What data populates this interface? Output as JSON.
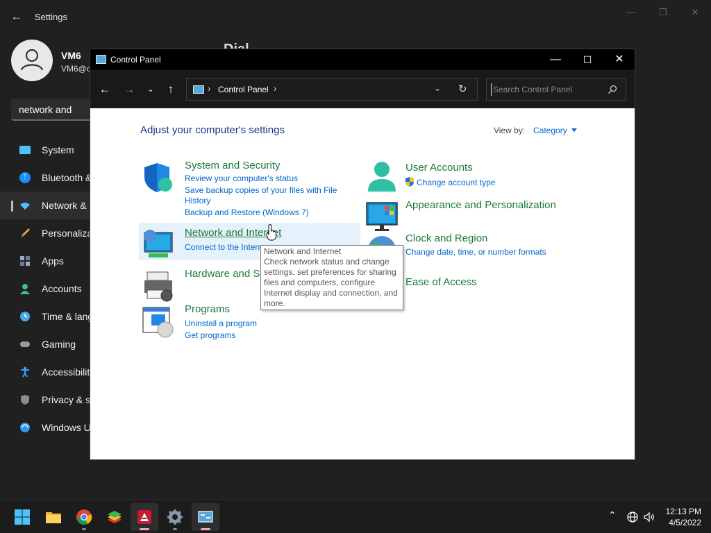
{
  "settings": {
    "title": "Settings",
    "user_name": "VM6",
    "user_email": "VM6@c",
    "page_peek": "Dial",
    "search_value": "network and",
    "nav": [
      {
        "label": "System",
        "icon": "system-icon",
        "color": "#4cc2ff"
      },
      {
        "label": "Bluetooth &",
        "icon": "bluetooth-icon",
        "color": "#1a8cff"
      },
      {
        "label": "Network &",
        "icon": "wifi-icon",
        "color": "#4cc2ff",
        "active": true
      },
      {
        "label": "Personaliza",
        "icon": "brush-icon",
        "color": "#f0a24a"
      },
      {
        "label": "Apps",
        "icon": "apps-icon",
        "color": "#9aa7c8"
      },
      {
        "label": "Accounts",
        "icon": "accounts-icon",
        "color": "#3dc08a"
      },
      {
        "label": "Time & lang",
        "icon": "clock-icon",
        "color": "#4aa8e8"
      },
      {
        "label": "Gaming",
        "icon": "gamepad-icon",
        "color": "#9a9a9a"
      },
      {
        "label": "Accessibility",
        "icon": "accessibility-icon",
        "color": "#3aa0ff"
      },
      {
        "label": "Privacy & se",
        "icon": "shield-icon",
        "color": "#8c8c8c"
      },
      {
        "label": "Windows U",
        "icon": "update-icon",
        "color": "#2f9be8"
      }
    ]
  },
  "control_panel": {
    "title": "Control Panel",
    "address": "Control Panel",
    "search_placeholder": "Search Control Panel",
    "heading": "Adjust your computer's settings",
    "view_by_label": "View by:",
    "view_by_value": "Category",
    "categories_left": [
      {
        "title": "System and Security",
        "icon": "shield-security-icon",
        "links": [
          "Review your computer's status",
          "Save backup copies of your files with File",
          "History",
          "Backup and Restore (Windows 7)"
        ]
      },
      {
        "title": "Network and Internet",
        "icon": "network-icon",
        "links": [
          "Connect to the Interne"
        ]
      },
      {
        "title": "Hardware and S",
        "icon": "printer-icon",
        "links": []
      },
      {
        "title": "Programs",
        "icon": "programs-icon",
        "links": [
          "Uninstall a program",
          "Get programs"
        ]
      }
    ],
    "categories_right": [
      {
        "title": "User Accounts",
        "icon": "user-accounts-icon",
        "links": [
          "Change account type"
        ]
      },
      {
        "title": "Appearance and Personalization",
        "icon": "appearance-icon",
        "links": []
      },
      {
        "title": "Clock and Region",
        "icon": "globe-clock-icon",
        "links": [
          "Change date, time, or number formats"
        ]
      },
      {
        "title": "Ease of Access",
        "icon": "ease-of-access-icon",
        "links": []
      }
    ],
    "tooltip": {
      "title": "Network and Internet",
      "body": "Check network status and change settings, set preferences for sharing files and computers, configure Internet display and connection, and more."
    }
  },
  "taskbar": {
    "apps": [
      "start-icon",
      "file-explorer-icon",
      "chrome-icon",
      "bluestacks-icon",
      "app-icon",
      "settings-icon",
      "control-panel-icon"
    ],
    "time": "12:13 PM",
    "date": "4/5/2022"
  }
}
